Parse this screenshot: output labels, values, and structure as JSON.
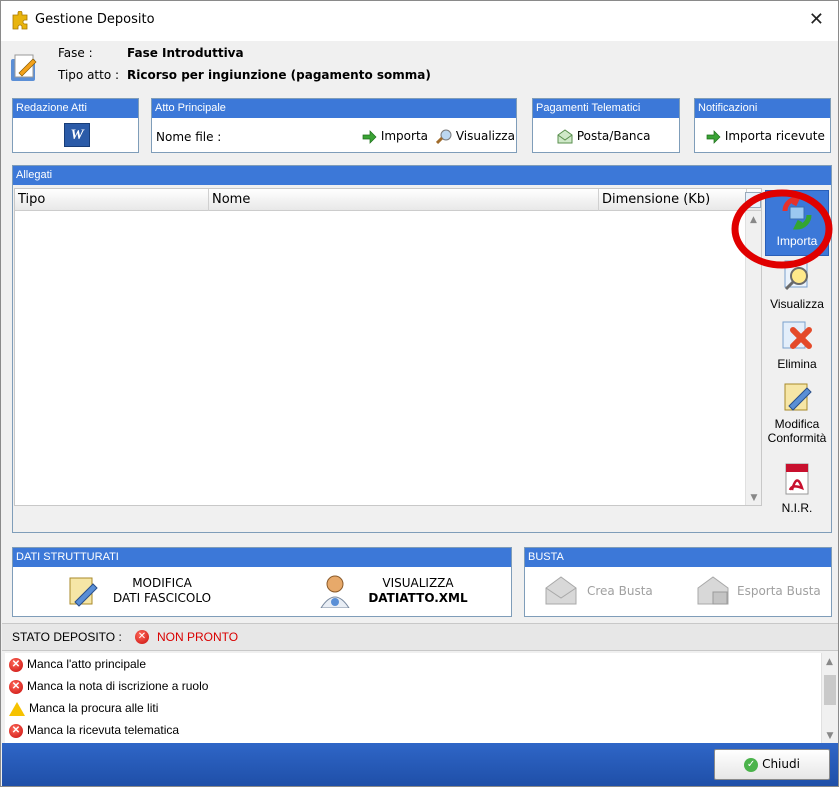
{
  "window": {
    "title": "Gestione Deposito"
  },
  "header": {
    "fase_label": "Fase :",
    "fase_value": "Fase Introduttiva",
    "tipo_label": "Tipo atto :",
    "tipo_value": "Ricorso per ingiunzione (pagamento somma)"
  },
  "redazione": {
    "title": "Redazione Atti"
  },
  "atto_principale": {
    "title": "Atto Principale",
    "nome_file_label": "Nome file :",
    "importa": "Importa",
    "visualizza": "Visualizza"
  },
  "pagamenti": {
    "title": "Pagamenti Telematici",
    "button": "Posta/Banca"
  },
  "notificazioni": {
    "title": "Notificazioni",
    "button": "Importa ricevute"
  },
  "allegati": {
    "title": "Allegati",
    "columns": [
      "Tipo",
      "Nome",
      "Dimensione (Kb)"
    ],
    "actions": {
      "importa": "Importa",
      "visualizza": "Visualizza",
      "elimina": "Elimina",
      "modifica_line1": "Modifica",
      "modifica_line2": "Conformità",
      "nir": "N.I.R."
    }
  },
  "dati_strutturati": {
    "title": "DATI STRUTTURATI",
    "modifica_line1": "MODIFICA",
    "modifica_line2": "DATI FASCICOLO",
    "visualizza_line1": "VISUALIZZA",
    "visualizza_line2": "DATIATTO.XML"
  },
  "busta": {
    "title": "BUSTA",
    "crea": "Crea Busta",
    "esporta": "Esporta Busta"
  },
  "stato": {
    "label": "STATO DEPOSITO :",
    "value": "NON PRONTO",
    "messages": [
      {
        "text": "Manca l'atto principale",
        "level": "error"
      },
      {
        "text": "Manca la nota di iscrizione a ruolo",
        "level": "error"
      },
      {
        "text": "Manca la procura alle liti",
        "level": "warning"
      },
      {
        "text": "Manca la ricevuta telematica",
        "level": "error"
      }
    ]
  },
  "footer": {
    "chiudi": "Chiudi"
  },
  "colors": {
    "accent_blue": "#3c78d8",
    "error_red": "#d90000",
    "highlight_circle": "#e00000"
  }
}
